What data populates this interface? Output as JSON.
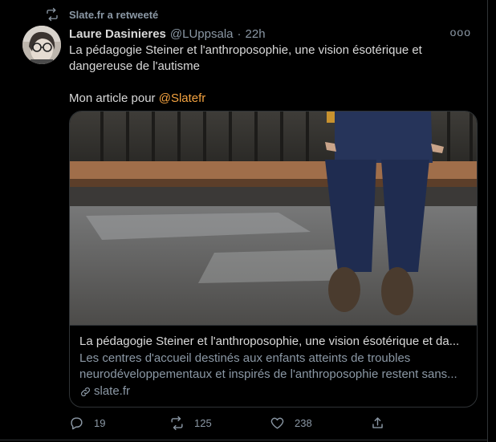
{
  "retweet": {
    "label": "Slate.fr a retweeté"
  },
  "author": {
    "name": "Laure Dasinieres",
    "handle": "@LUppsala",
    "separator": "·",
    "time": "22h"
  },
  "more_label": "ooo",
  "tweet": {
    "line1": "La pédagogie Steiner et l'anthroposophie, une vision ésotérique et dangereuse de l'autisme",
    "prefix": "Mon article pour ",
    "mention": "@Slatefr"
  },
  "card": {
    "title": "La pédagogie Steiner et l'anthroposophie, une vision ésotérique et da...",
    "desc_line1": "Les centres d'accueil destinés aux enfants atteints de troubles",
    "desc_line2": "neurodéveloppementaux et inspirés de l'anthroposophie restent sans...",
    "link": "slate.fr"
  },
  "actions": {
    "replies": "19",
    "retweets": "125",
    "likes": "238"
  },
  "icons": [
    "retweet-icon",
    "avatar",
    "more-icon",
    "link-icon",
    "reply-icon",
    "retweet-icon",
    "like-icon",
    "share-icon"
  ],
  "colors": {
    "background": "#000000",
    "text": "#d9d9d9",
    "muted": "#8b98a5",
    "mention": "#f4a340",
    "border": "#2f3336"
  }
}
